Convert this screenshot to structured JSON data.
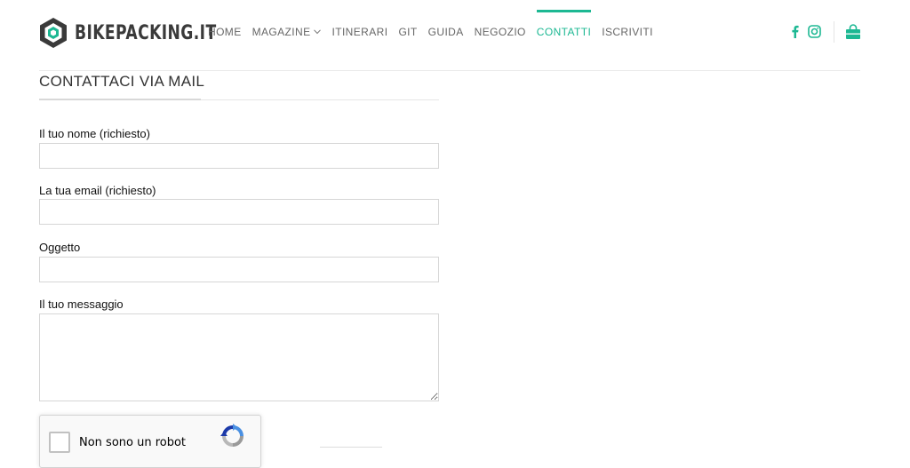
{
  "brand": {
    "name": "BIKEPACKING.IT",
    "accent_color": "#1db893",
    "logo_color": "#3a3a3a"
  },
  "nav": {
    "items": [
      {
        "label": "HOME",
        "active": false
      },
      {
        "label": "MAGAZINE",
        "active": false,
        "has_dropdown": true
      },
      {
        "label": "ITINERARI",
        "active": false
      },
      {
        "label": "GIT",
        "active": false
      },
      {
        "label": "GUIDA",
        "active": false
      },
      {
        "label": "NEGOZIO",
        "active": false
      },
      {
        "label": "CONTATTI",
        "active": true
      },
      {
        "label": "ISCRIVITI",
        "active": false
      }
    ],
    "icons": [
      "facebook-icon",
      "instagram-icon",
      "shopping-bag-icon"
    ]
  },
  "contact_form": {
    "title": "CONTATTACI VIA MAIL",
    "fields": [
      {
        "label": "Il tuo nome (richiesto)",
        "value": ""
      },
      {
        "label": "La tua email (richiesto)",
        "value": ""
      },
      {
        "label": "Oggetto",
        "value": ""
      },
      {
        "label": "Il tuo messaggio",
        "value": ""
      }
    ],
    "captcha": {
      "label": "Non sono un robot",
      "checked": false,
      "icon": "recaptcha-icon"
    }
  }
}
